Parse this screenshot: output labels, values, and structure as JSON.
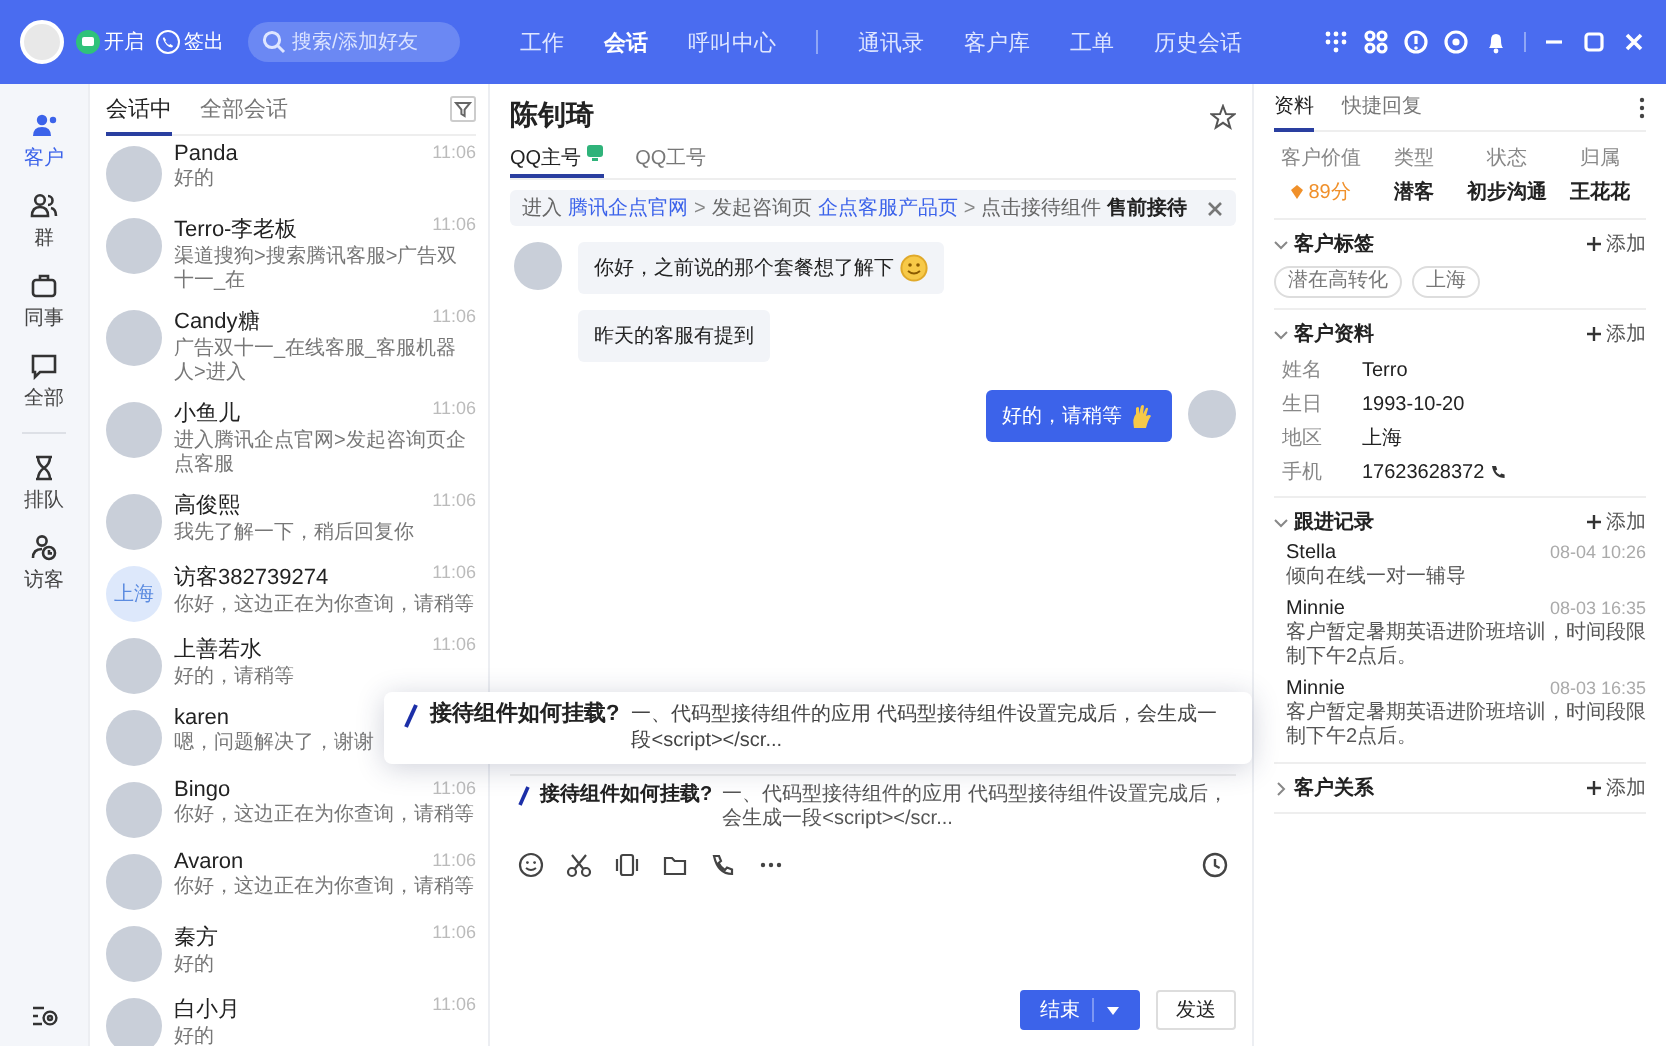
{
  "topbar": {
    "status_buttons": [
      {
        "label": "开启",
        "kind": "online"
      },
      {
        "label": "签出",
        "kind": "signout"
      }
    ],
    "search": {
      "placeholder": "搜索/添加好友"
    },
    "nav_groups": [
      [
        {
          "label": "工作",
          "selected": false
        },
        {
          "label": "会话",
          "selected": true
        },
        {
          "label": "呼叫中心",
          "selected": false
        }
      ],
      [
        {
          "label": "通讯录",
          "selected": false
        },
        {
          "label": "客户库",
          "selected": false
        },
        {
          "label": "工单",
          "selected": false
        },
        {
          "label": "历史会话",
          "selected": false
        }
      ]
    ]
  },
  "rail": {
    "groups": [
      [
        {
          "label": "客户",
          "selected": true
        },
        {
          "label": "群",
          "selected": false
        },
        {
          "label": "同事",
          "selected": false
        },
        {
          "label": "全部",
          "selected": false
        }
      ],
      [
        {
          "label": "排队",
          "selected": false
        },
        {
          "label": "访客",
          "selected": false
        }
      ]
    ]
  },
  "conversation_list": {
    "tabs": [
      {
        "label": "会话中",
        "selected": true
      },
      {
        "label": "全部会话",
        "selected": false
      }
    ],
    "items": [
      {
        "name": "Panda",
        "preview": "好的",
        "time": "11:06"
      },
      {
        "name": "Terro-李老板",
        "preview": "渠道搜狗>搜索腾讯客服>广告双十一_在",
        "time": "11:06"
      },
      {
        "name": "Candy糖",
        "preview": "广告双十一_在线客服_客服机器人>进入",
        "time": "11:06"
      },
      {
        "name": "小鱼儿",
        "preview": "进入腾讯企点官网>发起咨询页企点客服",
        "time": "11:06"
      },
      {
        "name": "高俊熙",
        "preview": "我先了解一下，稍后回复你",
        "time": "11:06"
      },
      {
        "name": "访客382739274",
        "preview": "你好，这边正在为你查询，请稍等",
        "time": "11:06",
        "avatar_text": "上海"
      },
      {
        "name": "上善若水",
        "preview": "好的，请稍等",
        "time": "11:06"
      },
      {
        "name": "karen",
        "preview": "嗯，问题解决了，谢谢"
      },
      {
        "name": "Bingo",
        "preview": "你好，这边正在为你查询，请稍等",
        "time": "11:06"
      },
      {
        "name": "Avaron",
        "preview": "你好，这边正在为你查询，请稍等",
        "time": "11:06"
      },
      {
        "name": "秦方",
        "preview": "好的",
        "time": "11:06"
      },
      {
        "name": "白小月",
        "preview": "好的",
        "time": "11:06"
      }
    ]
  },
  "chat": {
    "title": "陈钊琦",
    "tabs": [
      {
        "label": "QQ主号",
        "selected": true
      },
      {
        "label": "QQ工号",
        "selected": false
      }
    ],
    "breadcrumb": [
      {
        "text": "进入",
        "kind": "plain"
      },
      {
        "text": "腾讯企点官网",
        "kind": "link"
      },
      {
        "text": ">",
        "kind": "sep"
      },
      {
        "text": "发起咨询页",
        "kind": "plain"
      },
      {
        "text": "企点客服产品页",
        "kind": "link"
      },
      {
        "text": ">",
        "kind": "sep"
      },
      {
        "text": "点击接待组件",
        "kind": "plain"
      },
      {
        "text": "售前接待",
        "kind": "strong"
      }
    ],
    "messages": [
      {
        "kind": "incoming",
        "text": "你好，之前说的那个套餐想了解下",
        "emoji": true,
        "avatar": true
      },
      {
        "kind": "incoming",
        "text": "昨天的客服有提到",
        "emoji": false,
        "avatar": false
      },
      {
        "kind": "outgoing",
        "text": "好的，请稍等",
        "emoji": true,
        "avatar": true
      }
    ],
    "quick_reply": {
      "title": "接待组件如何挂载?",
      "text": "一、代码型接待组件的应用 代码型接待组件设置完成后，会生成一段<script></scr..."
    },
    "buttons": [
      {
        "label": "结束",
        "kind": "primary"
      },
      {
        "label": "发送",
        "kind": "default"
      }
    ]
  },
  "popup": {
    "title": "接待组件如何挂载?",
    "text": "一、代码型接待组件的应用 代码型接待组件设置完成后，会生成一段<script></scr..."
  },
  "profile": {
    "tabs": [
      {
        "label": "资料",
        "selected": true
      },
      {
        "label": "快捷回复",
        "selected": false
      }
    ],
    "stats": [
      {
        "label": "客户价值",
        "value": "89分",
        "kind": "score"
      },
      {
        "label": "类型",
        "value": "潜客",
        "kind": "plain"
      },
      {
        "label": "状态",
        "value": "初步沟通",
        "kind": "plain"
      },
      {
        "label": "归属",
        "value": "王花花",
        "kind": "plain"
      }
    ],
    "sections": [
      {
        "title": "客户标签",
        "expanded": true,
        "add_label": "添加",
        "kind": "tags",
        "tags": [
          "潜在高转化",
          "上海"
        ]
      },
      {
        "title": "客户资料",
        "expanded": true,
        "add_label": "添加",
        "kind": "fields",
        "fields": [
          {
            "label": "姓名",
            "value": "Terro"
          },
          {
            "label": "生日",
            "value": "1993-10-20"
          },
          {
            "label": "地区",
            "value": "上海"
          },
          {
            "label": "手机",
            "value": "17623628372",
            "kind": "phone"
          }
        ]
      },
      {
        "title": "跟进记录",
        "expanded": true,
        "add_label": "添加",
        "kind": "records",
        "records": [
          {
            "name": "Stella",
            "time": "08-04 10:26",
            "text": "倾向在线一对一辅导"
          },
          {
            "name": "Minnie",
            "time": "08-03 16:35",
            "text": "客户暂定暑期英语进阶班培训，时间段限制下午2点后。"
          },
          {
            "name": "Minnie",
            "time": "08-03 16:35",
            "text": "客户暂定暑期英语进阶班培训，时间段限制下午2点后。"
          }
        ]
      },
      {
        "title": "客户关系",
        "expanded": false,
        "add_label": "添加"
      }
    ]
  }
}
